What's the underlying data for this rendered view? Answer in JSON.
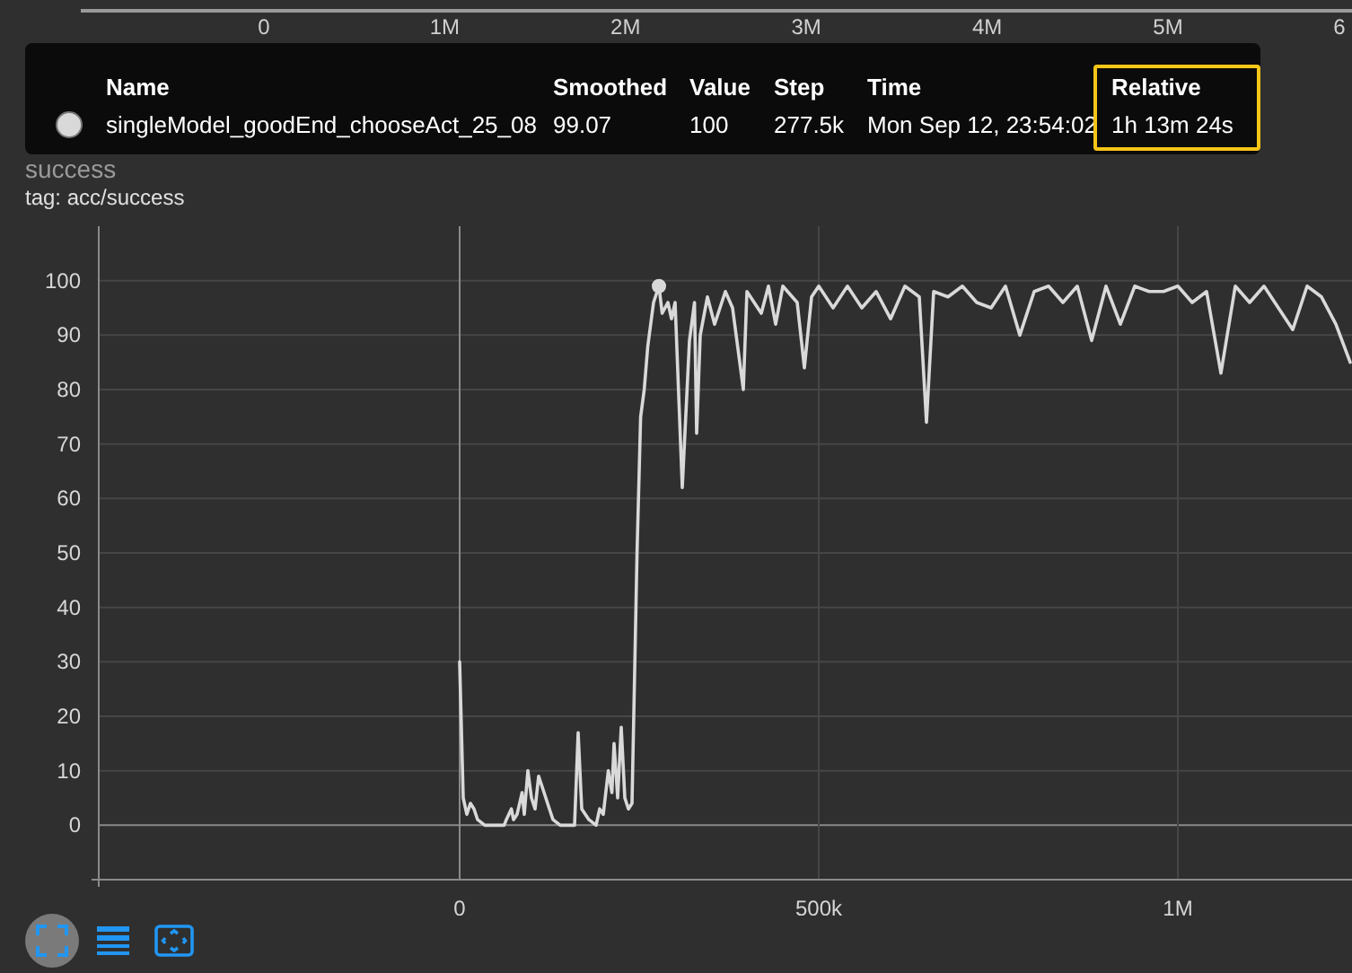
{
  "top_axis": {
    "labels": [
      "0",
      "1M",
      "2M",
      "3M",
      "4M",
      "5M",
      "6"
    ]
  },
  "tooltip": {
    "columns": [
      {
        "label": "Name",
        "highlighted": false
      },
      {
        "label": "Smoothed",
        "highlighted": false
      },
      {
        "label": "Value",
        "highlighted": false
      },
      {
        "label": "Step",
        "highlighted": false
      },
      {
        "label": "Time",
        "highlighted": false
      },
      {
        "label": "Relative",
        "highlighted": true
      }
    ],
    "rows": [
      {
        "color": "#d9d9d9",
        "cells": [
          "singleModel_goodEnd_chooseAct_25_08",
          "99.07",
          "100",
          "277.5k",
          "Mon Sep 12, 23:54:02",
          "1h 13m 24s"
        ]
      }
    ]
  },
  "card": {
    "title": "success",
    "tag": "tag: acc/success",
    "chart_data": {
      "type": "line",
      "xlim": [
        -502500,
        1242500
      ],
      "ylim": [
        -10,
        110
      ],
      "xticks": [
        {
          "value": 0,
          "label": "0"
        },
        {
          "value": 500000,
          "label": "500k"
        },
        {
          "value": 1000000,
          "label": "1M"
        }
      ],
      "yticks": [
        0,
        10,
        20,
        30,
        40,
        50,
        60,
        70,
        80,
        90,
        100
      ],
      "x": [
        0,
        5000,
        10000,
        15000,
        20000,
        25000,
        35000,
        50000,
        62000,
        65000,
        72000,
        75000,
        80000,
        87000,
        90000,
        95000,
        100000,
        105000,
        110000,
        115000,
        120000,
        125000,
        130000,
        140000,
        150000,
        160000,
        165000,
        170000,
        180000,
        190000,
        195000,
        200000,
        207000,
        212000,
        215000,
        220000,
        225000,
        230000,
        235000,
        240000,
        247000,
        252000,
        257000,
        262000,
        270000,
        277500,
        282000,
        290000,
        295000,
        300000,
        310000,
        320000,
        327000,
        330000,
        335000,
        345000,
        355000,
        370000,
        380000,
        395000,
        400000,
        420000,
        430000,
        440000,
        450000,
        470000,
        480000,
        490000,
        500000,
        520000,
        540000,
        560000,
        580000,
        600000,
        620000,
        640000,
        650000,
        660000,
        680000,
        700000,
        720000,
        740000,
        760000,
        780000,
        800000,
        820000,
        840000,
        860000,
        880000,
        900000,
        920000,
        940000,
        960000,
        980000,
        1000000,
        1020000,
        1040000,
        1060000,
        1080000,
        1100000,
        1120000,
        1140000,
        1160000,
        1180000,
        1200000,
        1220000,
        1240000
      ],
      "series": [
        {
          "color": "#d9d9d9",
          "values": [
            30,
            5,
            2,
            4,
            3,
            1,
            0,
            0,
            0,
            1,
            3,
            1,
            2,
            6,
            2,
            10,
            5,
            3,
            9,
            7,
            5,
            3,
            1,
            0,
            0,
            0,
            17,
            3,
            1,
            0,
            3,
            2,
            10,
            6,
            15,
            5,
            18,
            5,
            3,
            4,
            50,
            75,
            80,
            88,
            96,
            99,
            94,
            96,
            93,
            96,
            62,
            89,
            96,
            72,
            90,
            97,
            92,
            98,
            95,
            80,
            98,
            94,
            99,
            92,
            99,
            96,
            84,
            97,
            99,
            95,
            99,
            95,
            98,
            93,
            99,
            97,
            74,
            98,
            97,
            99,
            96,
            95,
            99,
            90,
            98,
            99,
            96,
            99,
            89,
            99,
            92,
            99,
            98,
            98,
            99,
            96,
            98,
            83,
            99,
            96,
            99,
            95,
            91,
            99,
            97,
            92,
            85
          ]
        }
      ],
      "grid": true
    }
  },
  "toolbar": [
    {
      "kind": "fullscreen",
      "selected": true
    },
    {
      "kind": "legend",
      "selected": false
    },
    {
      "kind": "fit",
      "selected": false
    }
  ]
}
